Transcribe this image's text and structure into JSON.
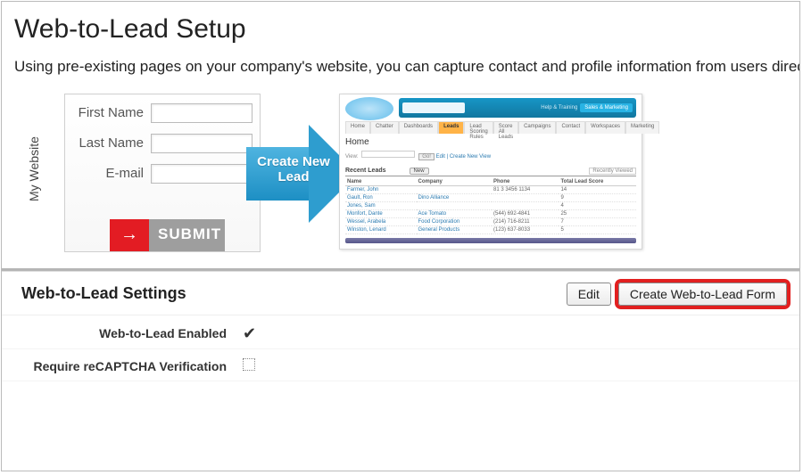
{
  "page": {
    "title": "Web-to-Lead Setup",
    "intro": "Using pre-existing pages on your company's website, you can capture contact and profile information from users directly into salesforce.com, enabling you to respond in real-time to customer requests."
  },
  "diagram": {
    "vlabel": "My Website",
    "form": {
      "first_name": "First Name",
      "last_name": "Last Name",
      "email": "E-mail",
      "submit": "SUBMIT"
    },
    "arrow_text": "Create New Lead",
    "sf": {
      "chip_label": "Sales & Marketing",
      "top_links": "Help & Training",
      "tabs": [
        "Home",
        "Chatter",
        "Dashboards",
        "Leads",
        "Lead Scoring Rules",
        "Score All Leads",
        "Campaigns",
        "Contact",
        "Workspaces",
        "Marketing"
      ],
      "active_tab": 3,
      "home": "Home",
      "viewbar": {
        "go": "Go!",
        "link": "Edit | Create New View"
      },
      "recent": {
        "title": "Recent Leads",
        "new": "New",
        "rv": "Recently Viewed"
      },
      "cols": [
        "Name",
        "Company",
        "Phone",
        "Total Lead Score"
      ],
      "rows": [
        {
          "name": "Farmer, John",
          "company": "",
          "phone": "81 3 3456 1134",
          "score": "14"
        },
        {
          "name": "Gault, Ron",
          "company": "Dino Alliance",
          "phone": "",
          "score": "9"
        },
        {
          "name": "Jones, Sam",
          "company": "",
          "phone": "",
          "score": "4"
        },
        {
          "name": "Monfort, Dante",
          "company": "Ace Tomato",
          "phone": "(544) 692-4841",
          "score": "25"
        },
        {
          "name": "Wessel, Arabela",
          "company": "Food Corporation",
          "phone": "(214) 716-8211",
          "score": "7"
        },
        {
          "name": "Winston, Lenard",
          "company": "General Products",
          "phone": "(123) 637-8033",
          "score": "5"
        }
      ]
    }
  },
  "settings": {
    "title": "Web-to-Lead Settings",
    "edit": "Edit",
    "create": "Create Web-to-Lead Form",
    "rows": {
      "enabled": {
        "label": "Web-to-Lead Enabled",
        "checked": true
      },
      "recaptcha": {
        "label": "Require reCAPTCHA Verification",
        "checked": false
      }
    }
  }
}
